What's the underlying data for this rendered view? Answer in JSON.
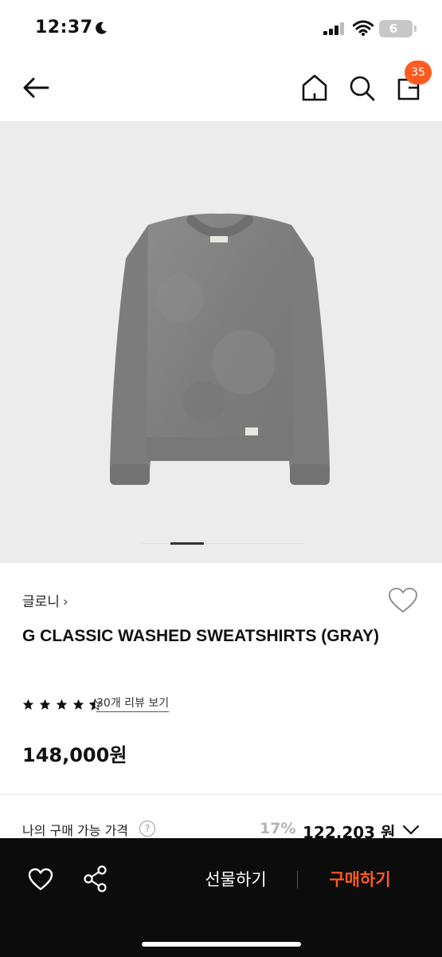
{
  "status": {
    "time": "12:37",
    "battery": "6"
  },
  "nav": {
    "cart_count": "35"
  },
  "product": {
    "brand": "글로니",
    "brand_chevron": "›",
    "title": "G CLASSIC WASHED SWEATSHIRTS (GRAY)",
    "rating": 4.5,
    "review_link": "30개 리뷰 보기",
    "price": "148,000원",
    "image_index": 1,
    "image_count": 5
  },
  "my_price": {
    "label": "나의 구매 가능 가격",
    "help": "?",
    "discount": "17%",
    "amount": "122,203 원"
  },
  "actions": {
    "gift_label": "선물하기",
    "buy_label": "구매하기"
  },
  "colors": {
    "accent": "#ff5a1f",
    "bottom_bar": "#0c0c0c",
    "hero_bg": "#ececec"
  },
  "icons": {
    "back": "arrow-left-icon",
    "home": "home-icon",
    "search": "search-icon",
    "cart": "shopping-bag-icon",
    "wish": "heart-icon",
    "share": "share-icon",
    "expand": "chevron-down-icon"
  }
}
